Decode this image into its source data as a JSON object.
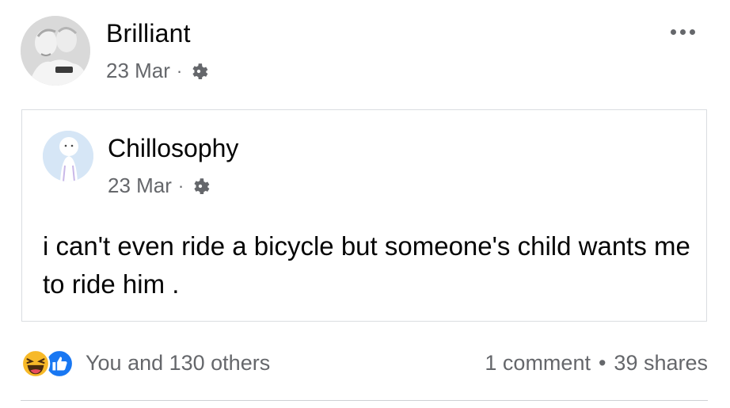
{
  "post": {
    "author": "Brilliant",
    "date": "23 Mar",
    "separator": "·",
    "privacy_icon": "gear-icon",
    "more_icon": "more-options-icon"
  },
  "shared": {
    "author": "Chillosophy",
    "date": "23 Mar",
    "separator": "·",
    "privacy_icon": "gear-icon",
    "text": "i can't even ride a bicycle but someone's child wants me to ride him ."
  },
  "engagement": {
    "reaction_icons": [
      "haha-icon",
      "like-icon"
    ],
    "reactions_text": "You and 130 others",
    "comments": "1 comment",
    "bullet": "•",
    "shares": "39 shares"
  },
  "colors": {
    "text": "#050505",
    "secondary": "#65676b",
    "like_blue": "#1877f2",
    "haha_yellow": "#f7b928",
    "border": "#dadde1"
  }
}
